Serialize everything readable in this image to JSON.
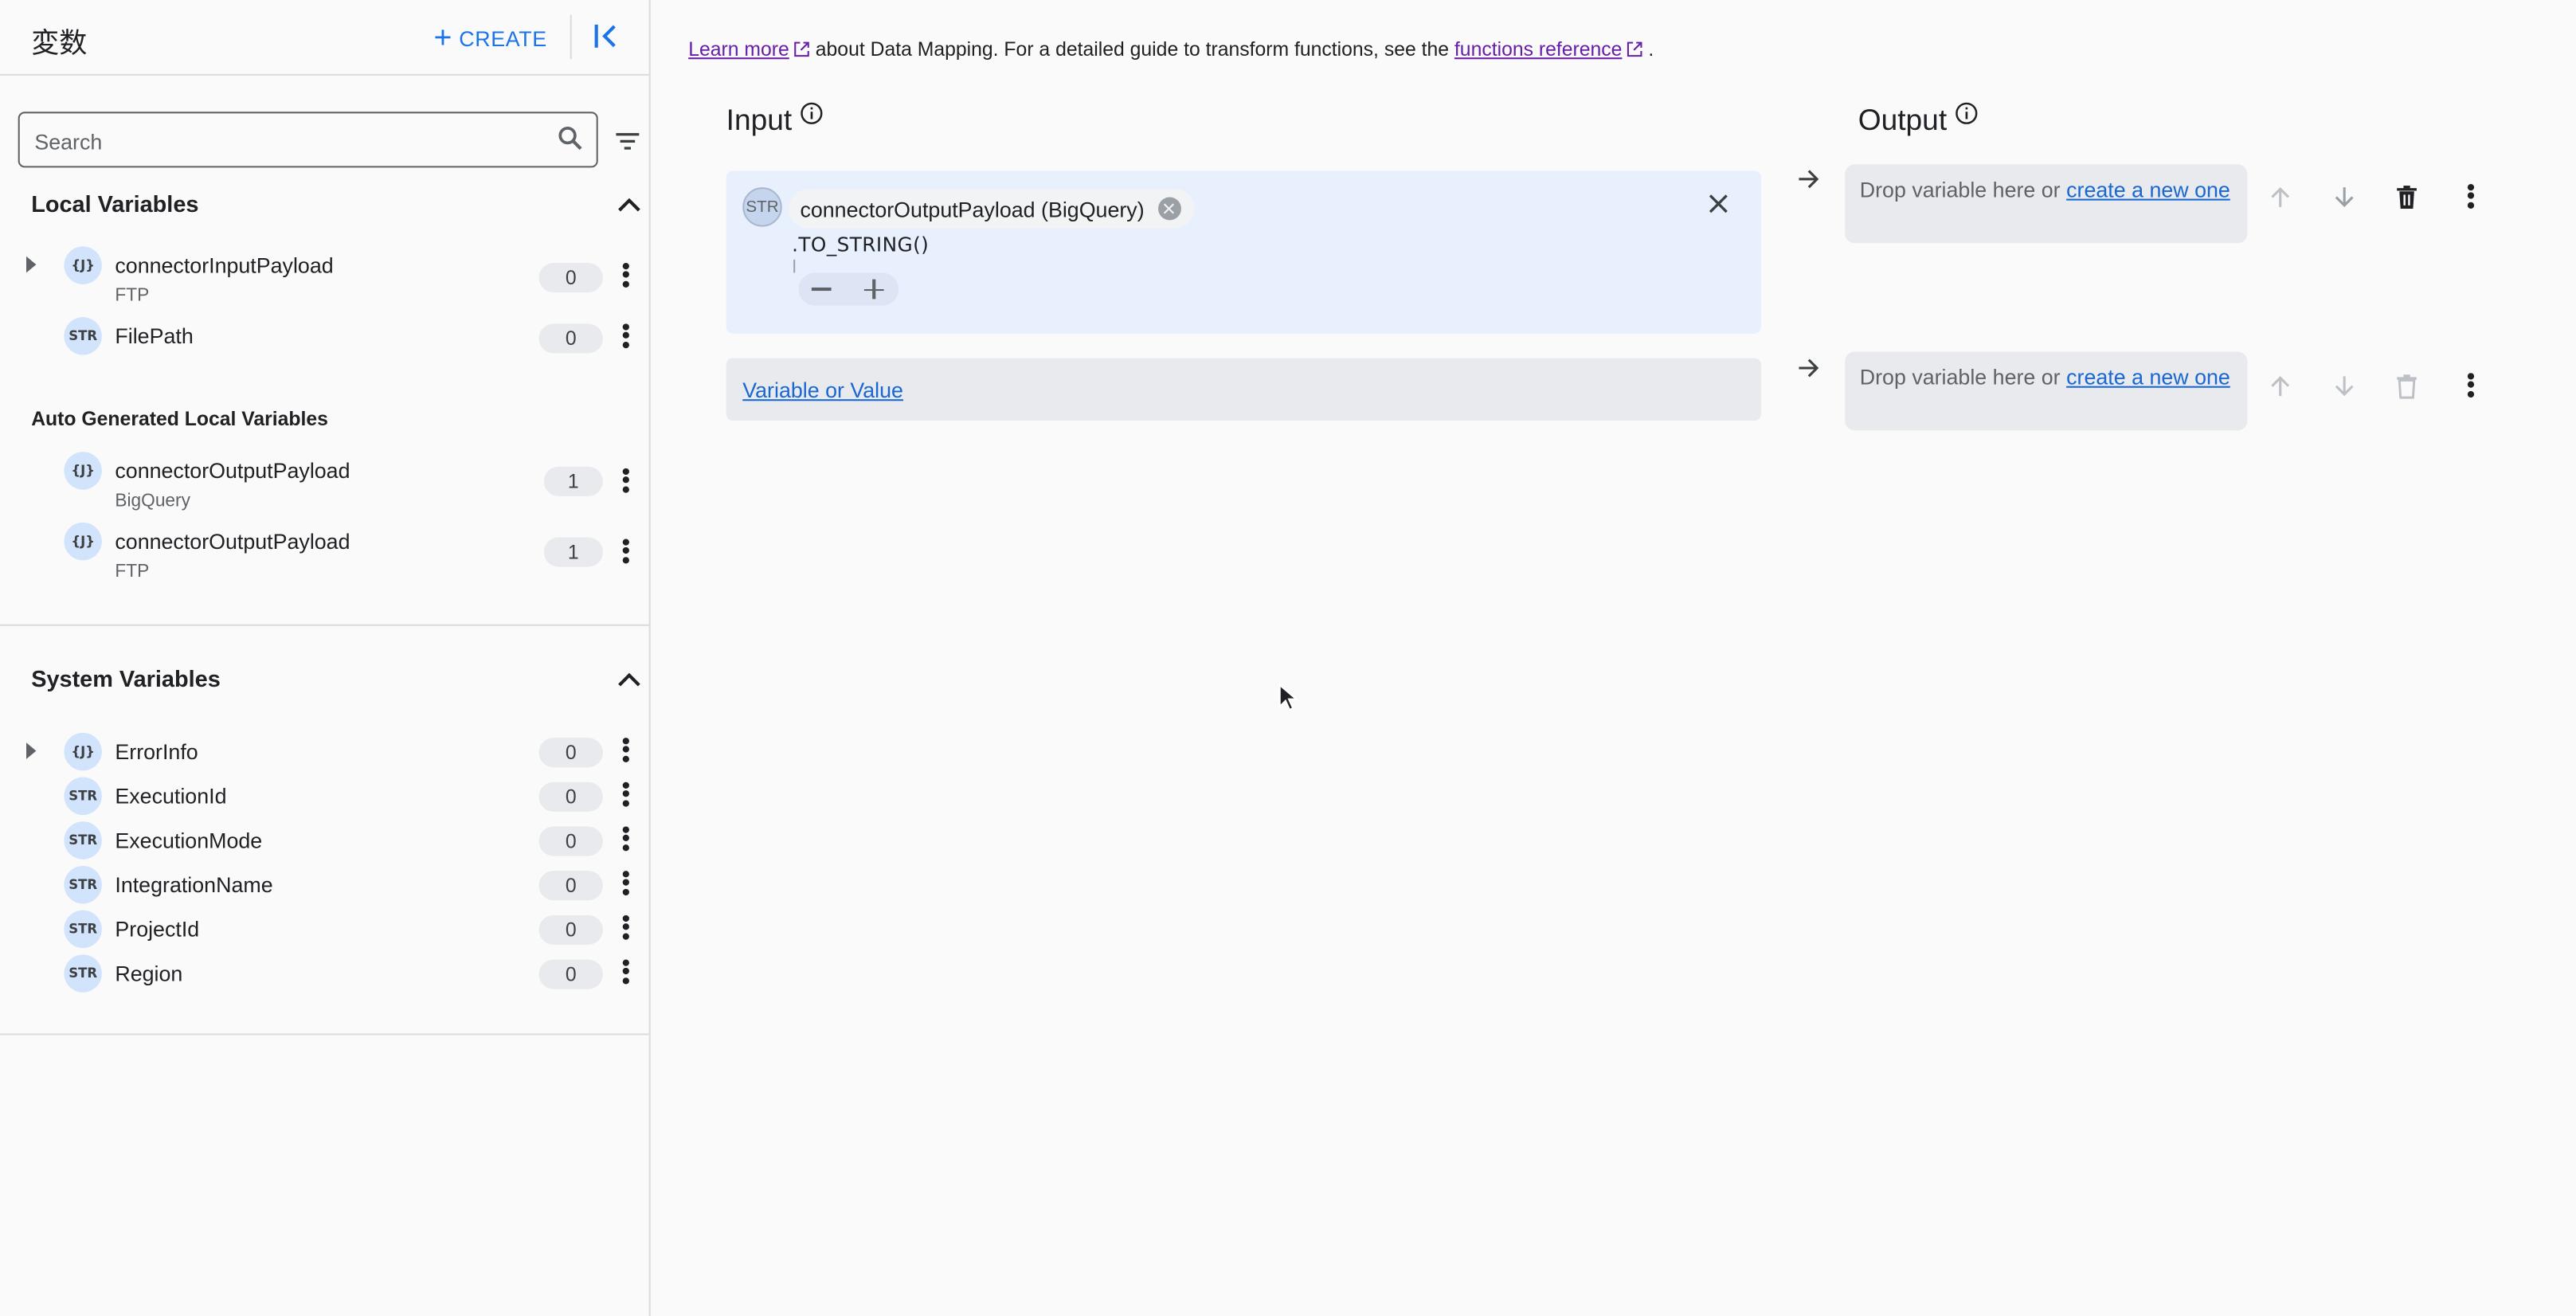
{
  "sidebar": {
    "title": "変数",
    "create_label": "CREATE",
    "search_placeholder": "Search",
    "local_title": "Local Variables",
    "local_items": [
      {
        "type": "{J}",
        "name": "connectorInputPayload",
        "sub": "FTP",
        "count": "0",
        "expandable": true
      },
      {
        "type": "STR",
        "name": "FilePath",
        "sub": "",
        "count": "0",
        "expandable": false
      }
    ],
    "auto_title": "Auto Generated Local Variables",
    "auto_items": [
      {
        "type": "{J}",
        "name": "connectorOutputPayload",
        "sub": "BigQuery",
        "count": "1"
      },
      {
        "type": "{J}",
        "name": "connectorOutputPayload",
        "sub": "FTP",
        "count": "1"
      }
    ],
    "system_title": "System Variables",
    "system_items": [
      {
        "type": "{J}",
        "name": "ErrorInfo",
        "count": "0",
        "expandable": true
      },
      {
        "type": "STR",
        "name": "ExecutionId",
        "count": "0"
      },
      {
        "type": "STR",
        "name": "ExecutionMode",
        "count": "0"
      },
      {
        "type": "STR",
        "name": "IntegrationName",
        "count": "0"
      },
      {
        "type": "STR",
        "name": "ProjectId",
        "count": "0"
      },
      {
        "type": "STR",
        "name": "Region",
        "count": "0"
      }
    ]
  },
  "main": {
    "info": {
      "learn_more": "Learn more",
      "middle": "about Data Mapping. For a detailed guide to transform functions, see the",
      "functions_ref": "functions reference",
      "end": "."
    },
    "input_title": "Input",
    "output_title": "Output",
    "input_row1": {
      "type": "STR",
      "chip": "connectorOutputPayload (BigQuery)",
      "function": ".TO_STRING()"
    },
    "input_row2": {
      "link": "Variable or Value"
    },
    "drop": {
      "text": "Drop variable here or",
      "link": "create a new one"
    }
  },
  "colors": {
    "accent": "#1a73e8",
    "link": "#1967d2",
    "visited": "#681da8",
    "card": "#e8f0fe"
  }
}
